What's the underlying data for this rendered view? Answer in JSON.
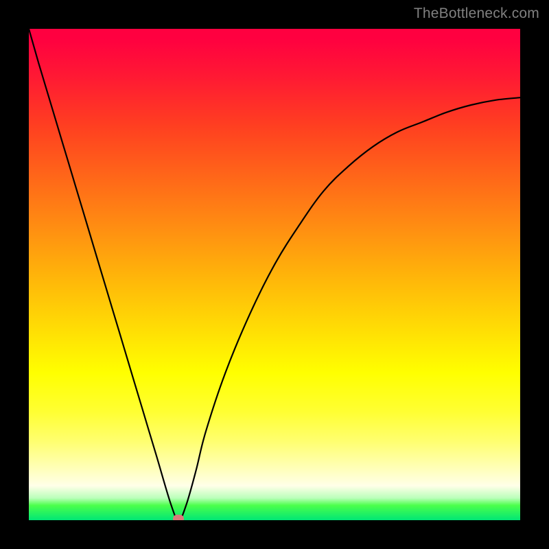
{
  "watermark": "TheBottleneck.com",
  "chart_data": {
    "type": "line",
    "title": "",
    "xlabel": "",
    "ylabel": "",
    "xlim": [
      0,
      100
    ],
    "ylim": [
      0,
      100
    ],
    "grid": false,
    "gradient_colors_top_to_bottom": [
      "#ff0040",
      "#ff6619",
      "#ffff00",
      "#ffffe8",
      "#00e676"
    ],
    "series": [
      {
        "name": "bottleneck-curve",
        "x": [
          0,
          2,
          5,
          8,
          11,
          14,
          17,
          20,
          23,
          26,
          29,
          30.5,
          32,
          34,
          36,
          40,
          45,
          50,
          55,
          60,
          65,
          70,
          75,
          80,
          85,
          90,
          95,
          100
        ],
        "y": [
          100,
          93,
          83,
          73,
          63,
          53,
          43,
          33,
          23,
          13,
          3,
          0,
          3,
          10,
          18,
          30,
          42,
          52,
          60,
          67,
          72,
          76,
          79,
          81,
          83,
          84.5,
          85.5,
          86
        ]
      }
    ],
    "marker": {
      "name": "optimal-point",
      "x": 30.5,
      "y": 0,
      "color": "#d97a7a"
    }
  }
}
